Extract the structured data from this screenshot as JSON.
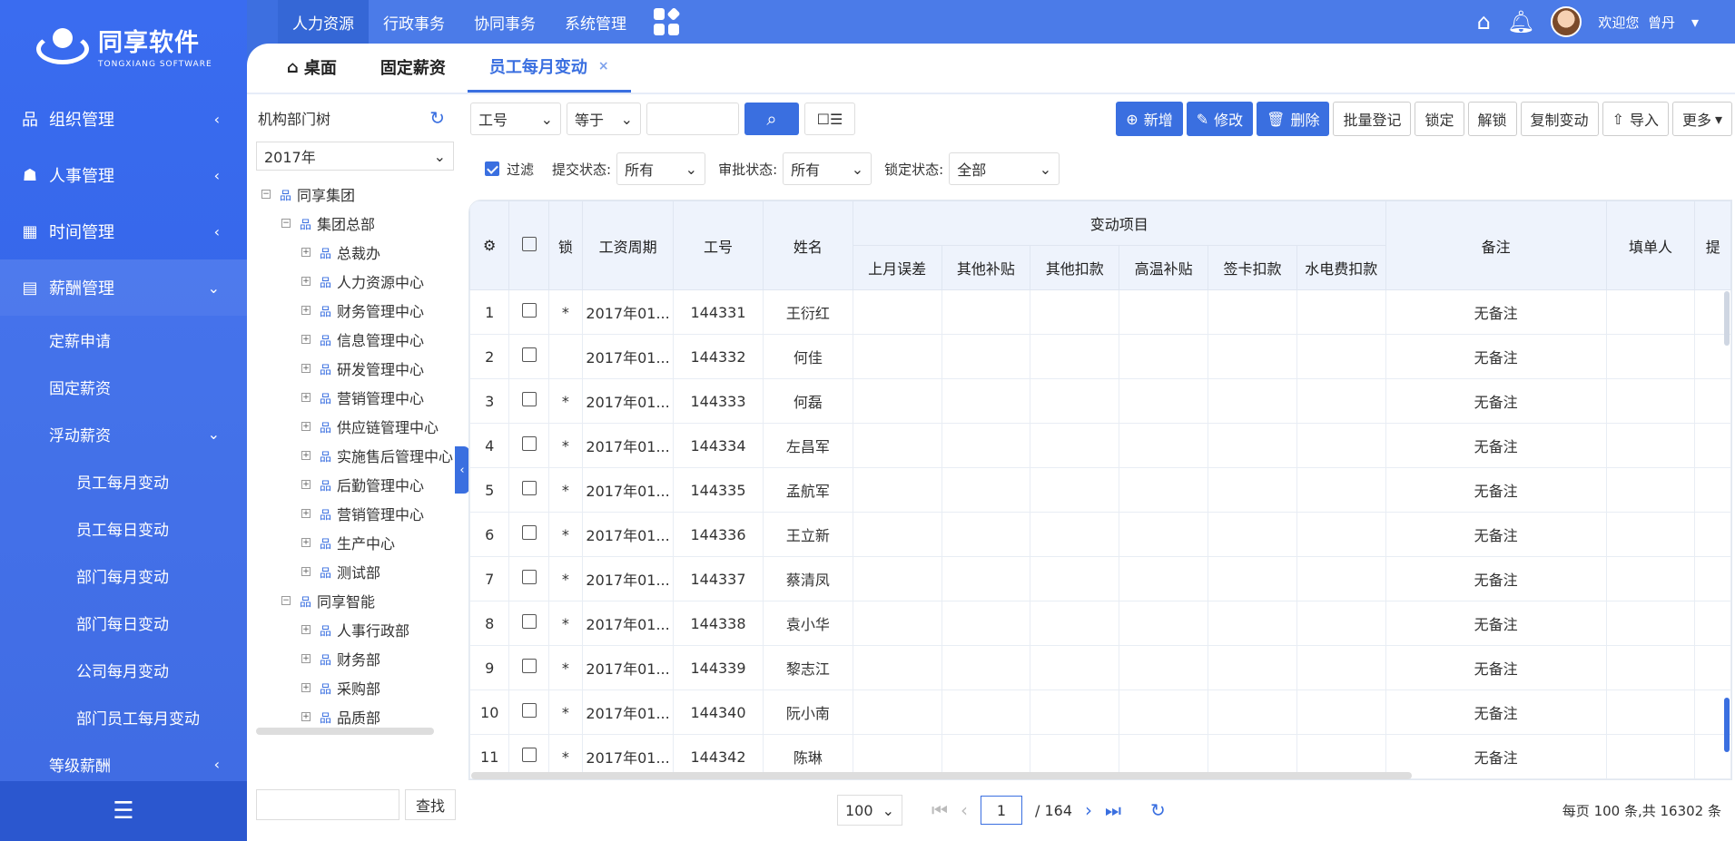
{
  "logo": {
    "name": "同享软件",
    "en": "TONGXIANG SOFTWARE"
  },
  "sidebar": {
    "menus": [
      {
        "label": "组织管理",
        "icon": "org-icon"
      },
      {
        "label": "人事管理",
        "icon": "people-icon"
      },
      {
        "label": "时间管理",
        "icon": "calendar-icon"
      },
      {
        "label": "薪酬管理",
        "icon": "salary-icon"
      }
    ],
    "salary_items": [
      "定薪申请",
      "固定薪资"
    ],
    "floating": "浮动薪资",
    "floating_items": [
      "员工每月变动",
      "员工每日变动",
      "部门每月变动",
      "部门每日变动",
      "公司每月变动",
      "部门员工每月变动"
    ],
    "last": "等级薪酬"
  },
  "topnav": [
    "人力资源",
    "行政事务",
    "协同事务",
    "系统管理"
  ],
  "user": {
    "welcome": "欢迎您",
    "name": "曾丹"
  },
  "tabs": [
    {
      "label": "桌面"
    },
    {
      "label": "固定薪资"
    },
    {
      "label": "员工每月变动",
      "close": "×"
    }
  ],
  "tree": {
    "title": "机构部门树",
    "year": "2017年",
    "nodes": [
      {
        "label": "同享集团",
        "level": 0,
        "exp": "−"
      },
      {
        "label": "集团总部",
        "level": 1,
        "exp": "−"
      },
      {
        "label": "总裁办",
        "level": 2,
        "exp": "+"
      },
      {
        "label": "人力资源中心",
        "level": 2,
        "exp": "+"
      },
      {
        "label": "财务管理中心",
        "level": 2,
        "exp": "+"
      },
      {
        "label": "信息管理中心",
        "level": 2,
        "exp": "+"
      },
      {
        "label": "研发管理中心",
        "level": 2,
        "exp": "+"
      },
      {
        "label": "营销管理中心",
        "level": 2,
        "exp": "+"
      },
      {
        "label": "供应链管理中心",
        "level": 2,
        "exp": "+"
      },
      {
        "label": "实施售后管理中心",
        "level": 2,
        "exp": "+"
      },
      {
        "label": "后勤管理中心",
        "level": 2,
        "exp": "+"
      },
      {
        "label": "营销管理中心",
        "level": 2,
        "exp": "+"
      },
      {
        "label": "生产中心",
        "level": 2,
        "exp": "+"
      },
      {
        "label": "测试部",
        "level": 2,
        "exp": "+"
      },
      {
        "label": "同享智能",
        "level": 1,
        "exp": "−"
      },
      {
        "label": "人事行政部",
        "level": 2,
        "exp": "+"
      },
      {
        "label": "财务部",
        "level": 2,
        "exp": "+"
      },
      {
        "label": "采购部",
        "level": 2,
        "exp": "+"
      },
      {
        "label": "品质部",
        "level": 2,
        "exp": "+"
      }
    ],
    "search_btn": "查找"
  },
  "toolbar": {
    "field": "工号",
    "op": "等于",
    "actions": [
      {
        "label": "新增",
        "style": "blue",
        "icon": "plus-icon"
      },
      {
        "label": "修改",
        "style": "blue",
        "icon": "edit-icon"
      },
      {
        "label": "删除",
        "style": "blue",
        "icon": "trash-icon"
      },
      {
        "label": "批量登记",
        "style": "plain"
      },
      {
        "label": "锁定",
        "style": "plain"
      },
      {
        "label": "解锁",
        "style": "plain"
      },
      {
        "label": "复制变动",
        "style": "plain"
      },
      {
        "label": "导入",
        "style": "plain",
        "icon": "upload-icon"
      },
      {
        "label": "更多",
        "style": "plain"
      }
    ]
  },
  "filters": {
    "filter_label": "过滤",
    "submit_label": "提交状态:",
    "submit_value": "所有",
    "approve_label": "审批状态:",
    "approve_value": "所有",
    "lock_label": "锁定状态:",
    "lock_value": "全部"
  },
  "table": {
    "headers": {
      "lock": "锁",
      "period": "工资周期",
      "no": "工号",
      "name": "姓名",
      "group": "变动项目",
      "note": "备注",
      "filler": "填单人",
      "last": "提"
    },
    "sub_headers": [
      "上月误差",
      "其他补贴",
      "其他扣款",
      "高温补贴",
      "签卡扣款",
      "水电费扣款"
    ],
    "rows": [
      {
        "idx": "1",
        "lock": "*",
        "period": "2017年01...",
        "no": "144331",
        "name": "王衍红",
        "note": "无备注"
      },
      {
        "idx": "2",
        "lock": "",
        "period": "2017年01...",
        "no": "144332",
        "name": "何佳",
        "note": "无备注"
      },
      {
        "idx": "3",
        "lock": "*",
        "period": "2017年01...",
        "no": "144333",
        "name": "何磊",
        "note": "无备注"
      },
      {
        "idx": "4",
        "lock": "*",
        "period": "2017年01...",
        "no": "144334",
        "name": "左昌军",
        "note": "无备注"
      },
      {
        "idx": "5",
        "lock": "*",
        "period": "2017年01...",
        "no": "144335",
        "name": "孟航军",
        "note": "无备注"
      },
      {
        "idx": "6",
        "lock": "*",
        "period": "2017年01...",
        "no": "144336",
        "name": "王立新",
        "note": "无备注"
      },
      {
        "idx": "7",
        "lock": "*",
        "period": "2017年01...",
        "no": "144337",
        "name": "蔡清凤",
        "note": "无备注"
      },
      {
        "idx": "8",
        "lock": "*",
        "period": "2017年01...",
        "no": "144338",
        "name": "袁小华",
        "note": "无备注"
      },
      {
        "idx": "9",
        "lock": "*",
        "period": "2017年01...",
        "no": "144339",
        "name": "黎志江",
        "note": "无备注"
      },
      {
        "idx": "10",
        "lock": "*",
        "period": "2017年01...",
        "no": "144340",
        "name": "阮小南",
        "note": "无备注"
      },
      {
        "idx": "11",
        "lock": "*",
        "period": "2017年01...",
        "no": "144342",
        "name": "陈琳",
        "note": "无备注"
      }
    ]
  },
  "pager": {
    "size": "100",
    "page": "1",
    "total": "/ 164",
    "summary": "每页 100 条,共 16302 条"
  },
  "colors": {
    "accent": "#3a6fe0",
    "sidebar": "#3a6cf0"
  }
}
